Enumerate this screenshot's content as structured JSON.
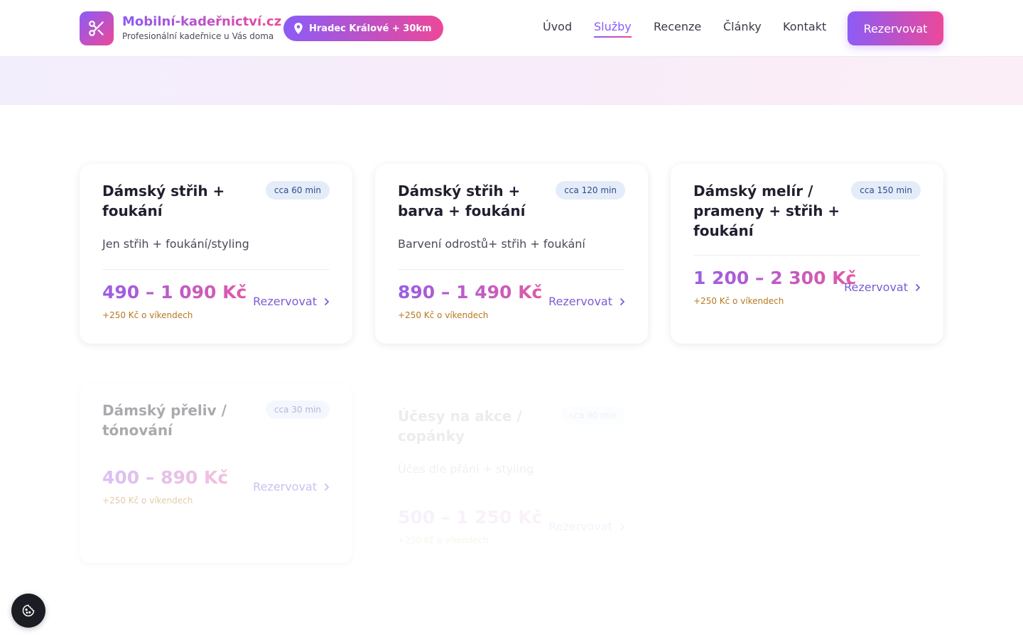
{
  "header": {
    "brand_name": "Mobilní-kadeřnictví.cz",
    "brand_tagline": "Profesionální kadeřnice u Vás doma",
    "location": "Hradec Králové + 30km",
    "nav": [
      "Úvod",
      "Služby",
      "Recenze",
      "Články",
      "Kontakt"
    ],
    "active_nav": "Služby",
    "cta_label": "Rezervovat"
  },
  "services": [
    {
      "title": "Dámský střih + foukání",
      "duration": "cca 60 min",
      "description": "Jen střih + foukání/styling",
      "price": "490 – 1 090 Kč",
      "weekend_note": "+250 Kč o víkendech",
      "book_label": "Rezervovat"
    },
    {
      "title": "Dámský střih + barva + foukání",
      "duration": "cca 120 min",
      "description": "Barvení odrostů+ střih + foukání",
      "price": "890 – 1 490 Kč",
      "weekend_note": "+250 Kč o víkendech",
      "book_label": "Rezervovat"
    },
    {
      "title": "Dámský melír / prameny + střih + foukání",
      "duration": "cca 150 min",
      "description": "",
      "price": "1 200 – 2 300 Kč",
      "weekend_note": "+250 Kč o víkendech",
      "book_label": "Rezervovat"
    },
    {
      "title": "Dámský přeliv / tónování",
      "duration": "cca 30 min",
      "description": "",
      "price": "400 – 890 Kč",
      "weekend_note": "+250 Kč o víkendech",
      "book_label": "Rezervovat"
    },
    {
      "title": "Účesy na akce / copánky",
      "duration": "cca 90 min",
      "description": "Účes dle přání + styling",
      "price": "500 – 1 250 Kč",
      "weekend_note": "+250 Kč o víkendech",
      "book_label": "Rezervovat"
    }
  ],
  "icons": {
    "logo": "scissors-icon",
    "location": "map-pin-icon",
    "book": "chevron-right-icon",
    "cookie": "cookie-icon"
  },
  "colors": {
    "brand_gradient_start": "#8b5cf6",
    "brand_gradient_end": "#ec4899",
    "badge_bg": "#e4ecfa",
    "weekend_note": "#b7791f",
    "book_link": "#7b5cd6"
  }
}
